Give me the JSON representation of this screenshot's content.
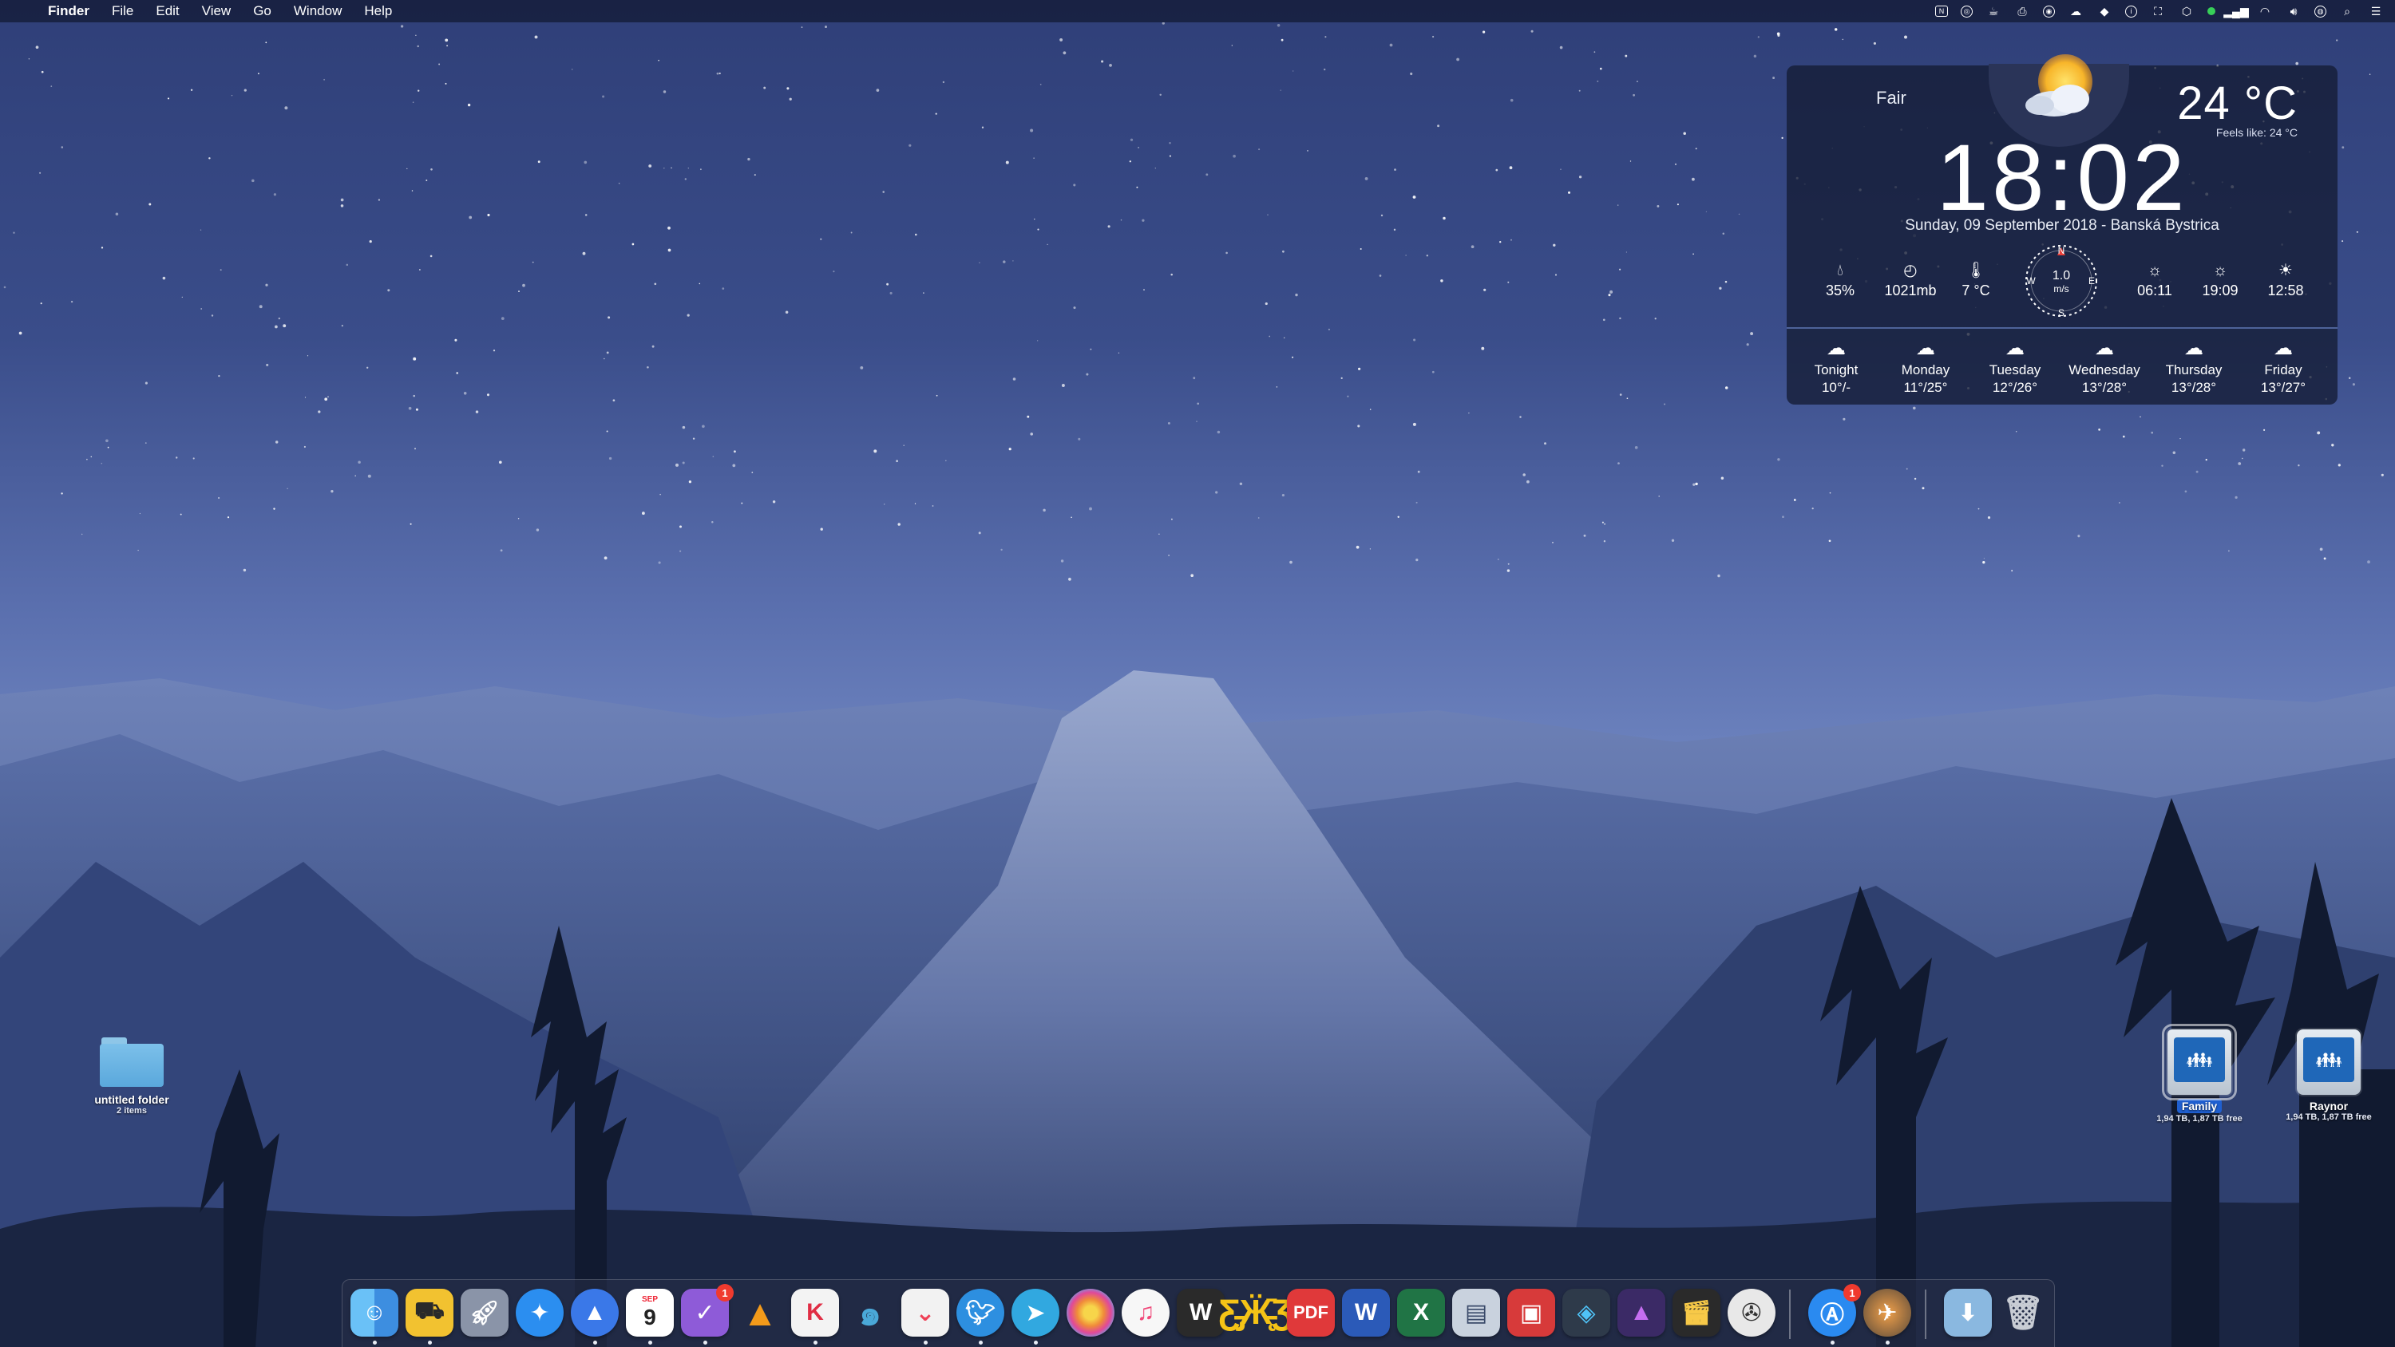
{
  "menubar": {
    "apple_icon": "apple-logo-icon",
    "app_name": "Finder",
    "menus": [
      "File",
      "Edit",
      "View",
      "Go",
      "Window",
      "Help"
    ],
    "status_icons": [
      "news-icon",
      "target-icon",
      "coffee-icon",
      "printer-icon",
      "compass-icon",
      "cloud-icon",
      "dropbox-icon",
      "istat-icon",
      "screen-icon",
      "shield-icon",
      "green-status-icon",
      "signal-icon",
      "wifi-icon",
      "volume-icon",
      "siri-icon",
      "spotlight-icon",
      "notification-center-icon"
    ]
  },
  "weather": {
    "condition": "Fair",
    "temperature": "24 °C",
    "feels_like": "Feels like:  24 °C",
    "time": "18:02",
    "date_location": "Sunday, 09 September 2018 - Banská Bystrica",
    "humidity": "35%",
    "pressure": "1021mb",
    "dew_point": "7 °C",
    "wind_speed": "1.0",
    "wind_unit": "m/s",
    "compass": {
      "n": "N",
      "e": "E",
      "s": "S",
      "w": "W"
    },
    "sunrise": "06:11",
    "sunset": "19:09",
    "daylight": "12:58",
    "forecast": [
      {
        "day": "Tonight",
        "temps": "10°/-"
      },
      {
        "day": "Monday",
        "temps": "11°/25°"
      },
      {
        "day": "Tuesday",
        "temps": "12°/26°"
      },
      {
        "day": "Wednesday",
        "temps": "13°/28°"
      },
      {
        "day": "Thursday",
        "temps": "13°/28°"
      },
      {
        "day": "Friday",
        "temps": "13°/27°"
      }
    ]
  },
  "desktop": {
    "folder": {
      "name": "untitled folder",
      "sub": "2 items"
    },
    "drives": [
      {
        "name": "Family",
        "sub": "1,94 TB, 1,87 TB free",
        "selected": true
      },
      {
        "name": "Raynor",
        "sub": "1,94 TB, 1,87 TB free",
        "selected": false
      }
    ]
  },
  "dock": {
    "calendar_month": "SEP",
    "calendar_day": "9",
    "badges": {
      "omnifocus": "1",
      "appstore": "1"
    },
    "items": [
      "finder",
      "forklift",
      "launchpad",
      "safari",
      "spark",
      "calendar",
      "omnifocus",
      "vlc",
      "klokki",
      "mosaic",
      "pocket",
      "tweetbot",
      "telegram",
      "photos",
      "itunes",
      "wikipedia",
      "tes",
      "pdf-expert",
      "word",
      "excel",
      "preview",
      "photo-booth",
      "layers",
      "affinity",
      "final-cut",
      "media",
      "app-store",
      "disk-utility",
      "downloads",
      "trash"
    ]
  }
}
